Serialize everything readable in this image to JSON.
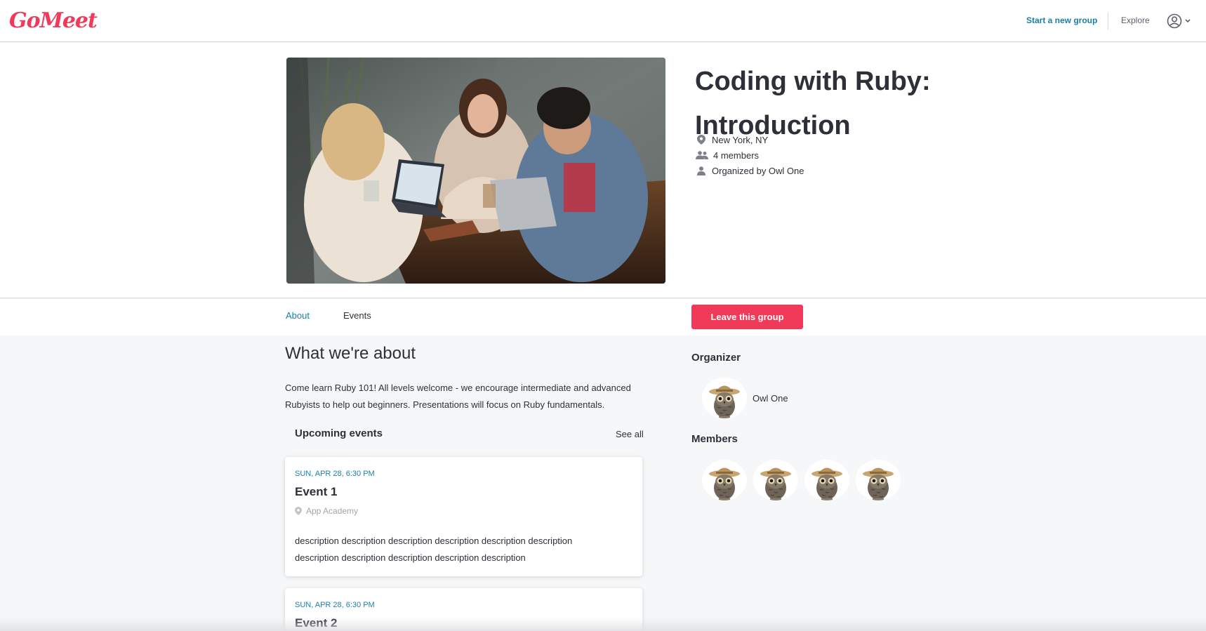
{
  "nav": {
    "logo": "GoMeet",
    "start_group": "Start a new group",
    "explore": "Explore",
    "account_icon": "user-circle-icon",
    "dropdown_icon": "chevron-down-icon"
  },
  "colors": {
    "brand": "#f13a59",
    "link": "#1a7fa8",
    "text": "#2e3039",
    "muted": "#a2a5ab",
    "page_bg": "#f6f7f8"
  },
  "group": {
    "title": "Coding with Ruby: Introduction",
    "location": "New York, NY",
    "members": "4 members",
    "organized_by": "Organized by Owl One",
    "location_icon": "map-pin-icon",
    "members_icon": "people-icon",
    "organizer_icon": "person-icon"
  },
  "tabs": [
    {
      "label": "About",
      "active": true
    },
    {
      "label": "Events",
      "active": false
    }
  ],
  "actions": {
    "leave": "Leave this group"
  },
  "about": {
    "heading": "What we're about",
    "text": "Come learn Ruby 101! All levels welcome - we encourage intermediate and advanced Rubyists to help out beginners. Presentations will focus on Ruby fundamentals."
  },
  "upcoming": {
    "heading": "Upcoming events",
    "see_all": "See all",
    "events": [
      {
        "date": "SUN, APR 28, 6:30 PM",
        "name": "Event 1",
        "location": "App Academy",
        "description": "description description description description description description description description description description description"
      },
      {
        "date": "SUN, APR 28, 6:30 PM",
        "name": "Event 2"
      }
    ]
  },
  "sidebar": {
    "organizer_heading": "Organizer",
    "organizer_name": "Owl One",
    "members_heading": "Members",
    "member_count_shown": 4
  }
}
